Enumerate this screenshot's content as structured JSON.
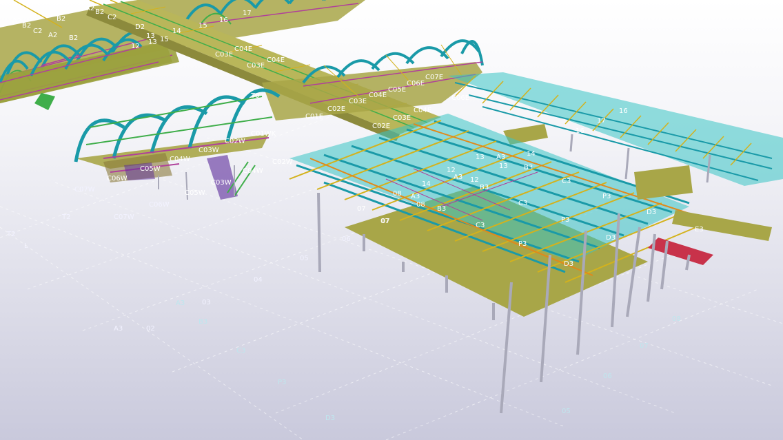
{
  "viewport": {
    "background_top": "#ffffff",
    "background_bottom": "#c9c9dc"
  },
  "colors": {
    "arch_teal": "#1a9aa8",
    "arch_green": "#3fae4a",
    "truss_magenta": "#b0409a",
    "beam_yellow": "#d4b21c",
    "beam_orange": "#e0891c",
    "slab_olive": "#a8a648",
    "deck_cyan": "#38c4c4",
    "column_gray": "#a9a9b9",
    "purple": "#5a2a9a",
    "red_panel": "#c8324a",
    "grid_line": "#ffffff"
  },
  "grid_labels": {
    "left_axis": [
      "T2",
      "T2",
      "C07W",
      "C07W",
      "C06W",
      "A3",
      "02",
      "03",
      "04",
      "05",
      "06",
      "07",
      "L"
    ],
    "front_axis": [
      "A3",
      "B3",
      "C3",
      "P3",
      "D3",
      "05",
      "06",
      "07",
      "08"
    ]
  },
  "member_labels": {
    "top_arches": [
      "A2",
      "B2",
      "C2",
      "B2",
      "A2",
      "B2",
      "C2",
      "D2",
      "13",
      "14",
      "15",
      "16",
      "17",
      "12",
      "13",
      "15",
      "B2",
      "A2"
    ],
    "mid_corridor": [
      "C03E",
      "C04E",
      "C03E",
      "C04E",
      "C05E",
      "C06E",
      "C07E",
      "C03E",
      "C04E",
      "C01E",
      "C02E",
      "C03E",
      "C04E",
      "C06E",
      "T0",
      "C02E"
    ],
    "west_corridor": [
      "C01WK",
      "C02W",
      "C03W",
      "C04W",
      "C05W",
      "C06W",
      "C03W",
      "C02W",
      "C04W",
      "C05W"
    ],
    "deck": [
      "14",
      "13",
      "A3",
      "13",
      "B3",
      "12",
      "A3",
      "12",
      "B3",
      "C3",
      "P3",
      "08",
      "A3",
      "08",
      "B3",
      "C3",
      "C3",
      "P3",
      "D3",
      "P3",
      "D3",
      "D3",
      "07",
      "07",
      "E3",
      "16",
      "17",
      "16",
      "14"
    ]
  }
}
